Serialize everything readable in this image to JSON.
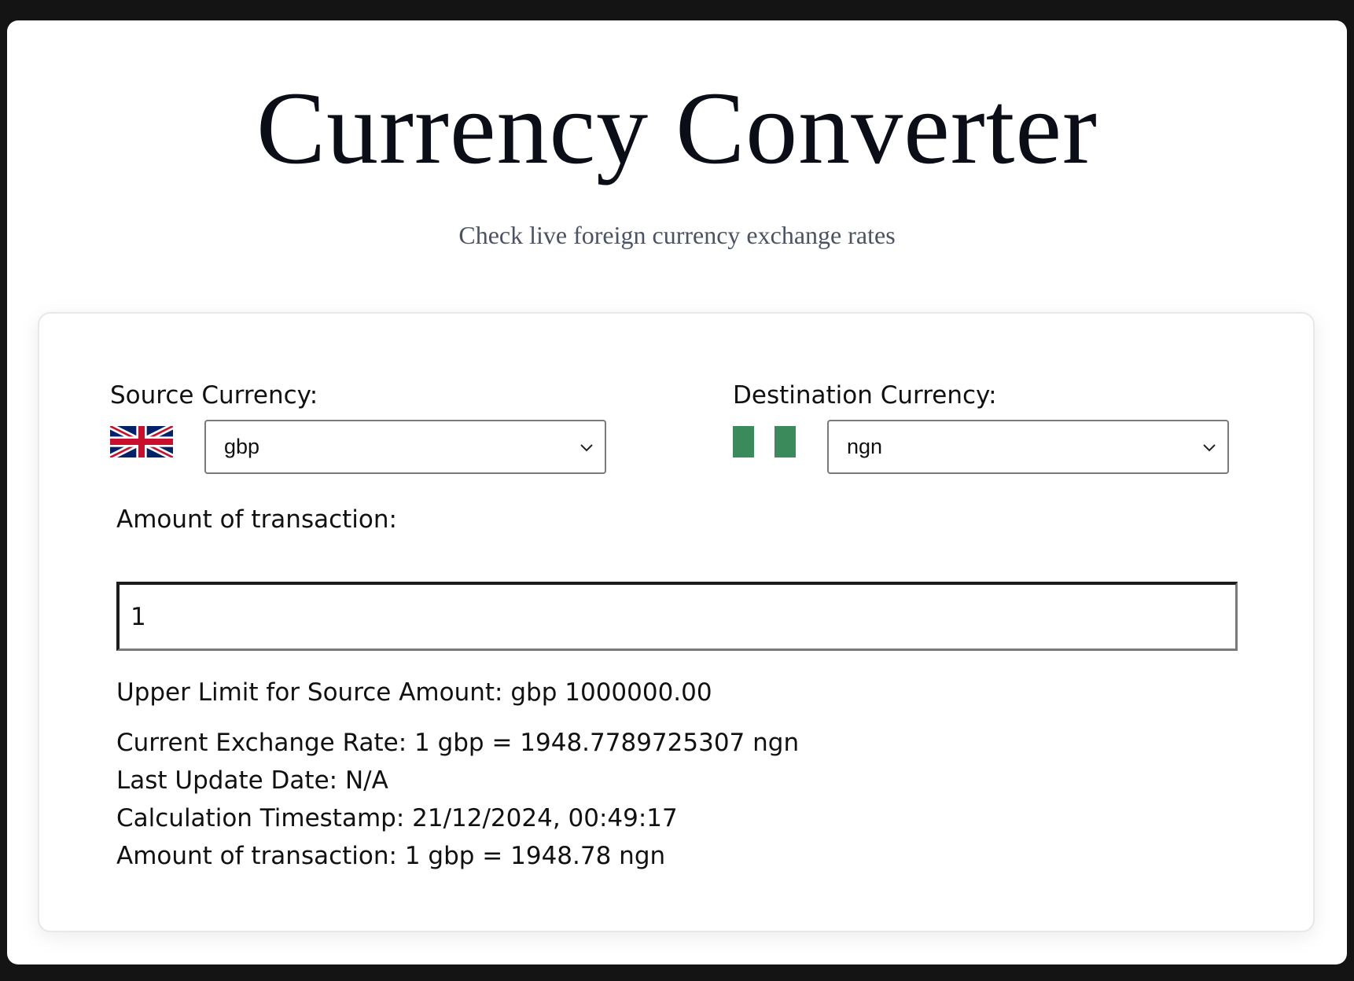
{
  "header": {
    "title": "Currency Converter",
    "subtitle": "Check live foreign currency exchange rates"
  },
  "source": {
    "label": "Source Currency:",
    "selected": "gbp",
    "flag_icon": "uk-flag-icon"
  },
  "destination": {
    "label": "Destination Currency:",
    "selected": "ngn",
    "flag_icon": "nigeria-flag-icon"
  },
  "amount": {
    "label": "Amount of transaction:",
    "value": "1"
  },
  "info": {
    "upper_limit_label": "Upper Limit for Source Amount:",
    "upper_limit_value": "gbp 1000000.00",
    "exchange_rate_label": "Current Exchange Rate:",
    "exchange_rate_value": "1 gbp = 1948.7789725307 ngn",
    "last_update_label": "Last Update Date:",
    "last_update_value": "N/A",
    "timestamp_label": "Calculation Timestamp:",
    "timestamp_value": "21/12/2024, 00:49:17",
    "result_label": "Amount of transaction:",
    "result_value": "1 gbp = 1948.78 ngn"
  },
  "colors": {
    "page_background": "#141414",
    "nigeria_green": "#3b8a5c",
    "uk_blue": "#012169",
    "uk_red": "#c8102e",
    "title_text": "#0b0e17",
    "subtitle_text": "#4a5263"
  }
}
